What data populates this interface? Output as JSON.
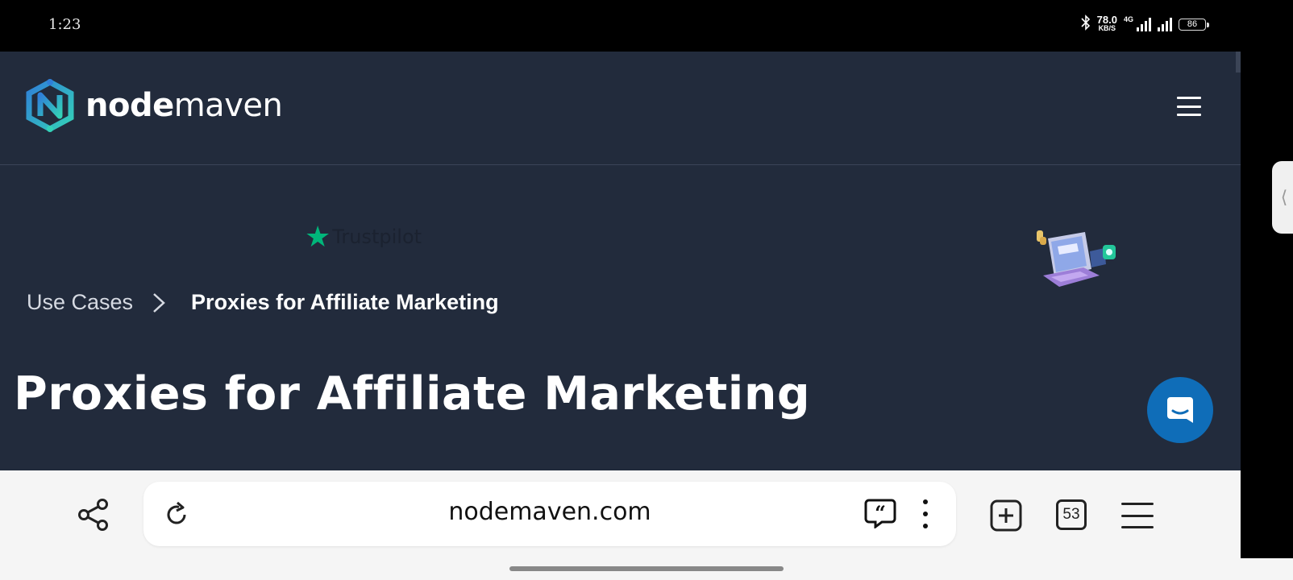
{
  "status_bar": {
    "time": "1:23",
    "net_speed": "78.0",
    "net_speed_unit": "KB/S",
    "network_type": "4G",
    "battery": "86"
  },
  "site": {
    "logo_bold": "node",
    "logo_light": "maven",
    "trustpilot_label": "Trustpilot",
    "breadcrumb": {
      "parent": "Use Cases",
      "current": "Proxies for Affiliate Marketing"
    },
    "title": "Proxies for Affiliate Marketing"
  },
  "browser": {
    "url": "nodemaven.com",
    "tab_count": "53"
  },
  "colors": {
    "page_background": "#222b3c",
    "brand_teal": "#2ec4b6",
    "brand_blue": "#2f7fd8",
    "trustpilot_green": "#00b67a",
    "chat_button": "#0f6db8",
    "toolbar_background": "#f5f5f5"
  },
  "icons": {
    "menu": "hamburger-icon",
    "chat": "chat-bubble-icon",
    "share": "share-icon",
    "reload": "reload-icon",
    "quote": "quote-icon",
    "more": "more-vertical-icon",
    "new_tab": "plus-square-icon",
    "browser_menu": "menu-icon"
  }
}
